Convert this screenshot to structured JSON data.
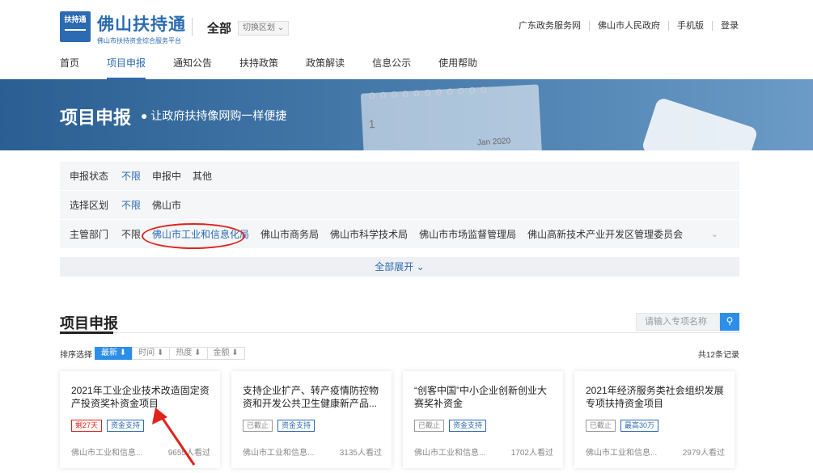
{
  "header": {
    "logo_text": "扶持通",
    "brand_name": "佛山扶持通",
    "brand_sub": "佛山市扶持资金综合服务平台",
    "region": "全部",
    "switch_label": "切换区划 ⌄",
    "links": [
      "广东政务服务网",
      "佛山市人民政府",
      "手机版",
      "登录"
    ]
  },
  "nav": [
    "首页",
    "项目申报",
    "通知公告",
    "扶持政策",
    "政策解读",
    "信息公示",
    "使用帮助"
  ],
  "banner": {
    "title": "项目申报",
    "slogan": "● 让政府扶持像网购一样便捷",
    "calendar_num": "1",
    "calendar_date": "Jan 2020"
  },
  "filters": {
    "status": {
      "label": "申报状态",
      "options": [
        "不限",
        "申报中",
        "其他"
      ]
    },
    "region": {
      "label": "选择区划",
      "options": [
        "不限",
        "佛山市"
      ]
    },
    "dept": {
      "label": "主管部门",
      "options": [
        "不限",
        "佛山市工业和信息化局",
        "佛山市商务局",
        "佛山市科学技术局",
        "佛山市市场监督管理局",
        "佛山高新技术产业开发区管理委员会"
      ]
    },
    "expand_label": "全部展开 ⌄"
  },
  "section": {
    "title": "项目申报",
    "search_placeholder": "请输入专项名称",
    "sort_label": "排序选择",
    "sort_buttons": [
      "最新 ⬇",
      "时间 ⬇",
      "热度 ⬇",
      "金额 ⬇"
    ],
    "total": "共12条记录"
  },
  "cards": [
    {
      "title": "2021年工业企业技术改造固定资产投资奖补资金项目",
      "tags": [
        "剩27天",
        "资金支持"
      ],
      "dept": "佛山市工业和信息...",
      "views": "9655人看过"
    },
    {
      "title": "支持企业扩产、转产疫情防控物资和开发公共卫生健康新产品...",
      "tags": [
        "已截止",
        "资金支持"
      ],
      "dept": "佛山市工业和信息...",
      "views": "3135人看过"
    },
    {
      "title": "“创客中国”中小企业创新创业大赛奖补资金",
      "tags": [
        "已截止",
        "资金支持"
      ],
      "dept": "佛山市工业和信息...",
      "views": "1702人看过"
    },
    {
      "title": "2021年经济服务类社会组织发展专项扶持资金项目",
      "tags": [
        "已截止",
        "最高30万"
      ],
      "dept": "佛山市工业和信息...",
      "views": "2979人看过"
    }
  ],
  "colors": {
    "primary": "#2c6bb2",
    "accent": "#2c8ee8",
    "annotation": "#e0231c"
  }
}
